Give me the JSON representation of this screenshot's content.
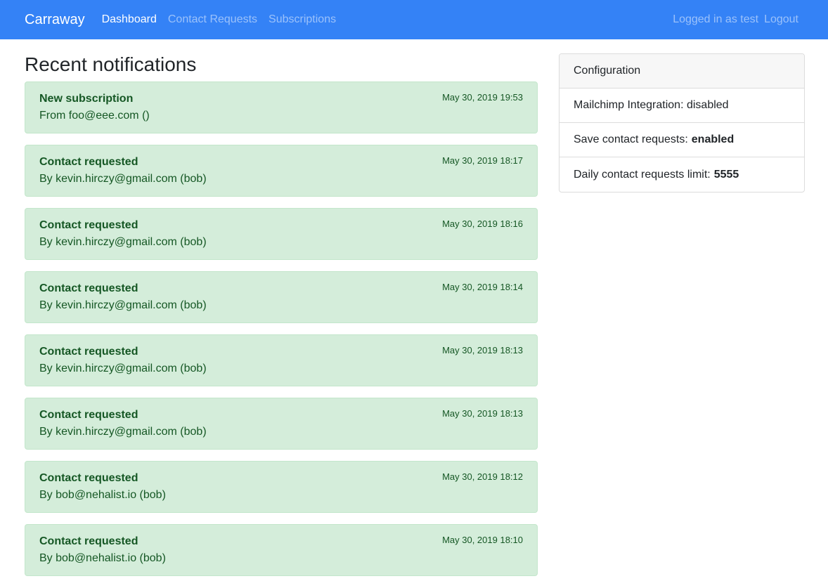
{
  "colors": {
    "navbar": "#3482f6",
    "alert_bg": "#d4edda",
    "alert_text": "#155724"
  },
  "navbar": {
    "brand": "Carraway",
    "links": [
      {
        "label": "Dashboard",
        "active": true
      },
      {
        "label": "Contact Requests",
        "active": false
      },
      {
        "label": "Subscriptions",
        "active": false
      }
    ],
    "logged_in": "Logged in as test",
    "logout": "Logout"
  },
  "main": {
    "title": "Recent notifications",
    "notifications": [
      {
        "title": "New subscription",
        "body": "From foo@eee.com ()",
        "time": "May 30, 2019 19:53"
      },
      {
        "title": "Contact requested",
        "body": "By kevin.hirczy@gmail.com (bob)",
        "time": "May 30, 2019 18:17"
      },
      {
        "title": "Contact requested",
        "body": "By kevin.hirczy@gmail.com (bob)",
        "time": "May 30, 2019 18:16"
      },
      {
        "title": "Contact requested",
        "body": "By kevin.hirczy@gmail.com (bob)",
        "time": "May 30, 2019 18:14"
      },
      {
        "title": "Contact requested",
        "body": "By kevin.hirczy@gmail.com (bob)",
        "time": "May 30, 2019 18:13"
      },
      {
        "title": "Contact requested",
        "body": "By kevin.hirczy@gmail.com (bob)",
        "time": "May 30, 2019 18:13"
      },
      {
        "title": "Contact requested",
        "body": "By bob@nehalist.io (bob)",
        "time": "May 30, 2019 18:12"
      },
      {
        "title": "Contact requested",
        "body": "By bob@nehalist.io (bob)",
        "time": "May 30, 2019 18:10"
      }
    ]
  },
  "config": {
    "header": "Configuration",
    "mailchimp_label": "Mailchimp Integration: disabled",
    "save_label": "Save contact requests:",
    "save_value": "enabled",
    "limit_label": "Daily contact requests limit:",
    "limit_value": "5555"
  }
}
